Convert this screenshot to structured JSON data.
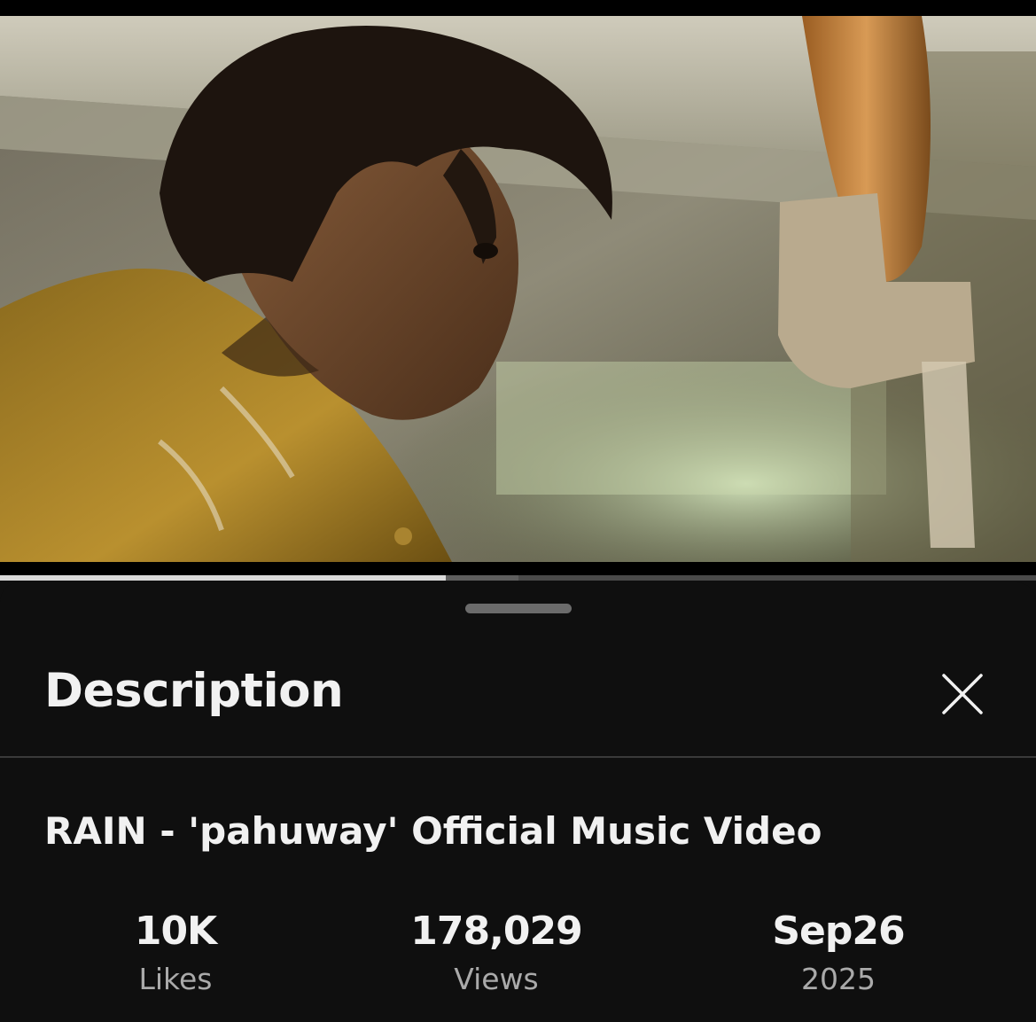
{
  "video": {
    "progress_played": 0.43,
    "progress_buffered": 0.5
  },
  "sheet": {
    "title": "Description",
    "close_icon": "close-icon"
  },
  "description": {
    "video_title": "RAIN - 'pahuway' Official Music Video",
    "stats": [
      {
        "value": "10K",
        "label": "Likes"
      },
      {
        "value": "178,029",
        "label": "Views"
      },
      {
        "value": "Sep26",
        "label": "2025"
      }
    ]
  },
  "colors": {
    "background": "#0f0f0f",
    "text_primary": "#f1f1f1",
    "text_secondary": "#aaaaaa",
    "divider": "#3a3a3a"
  }
}
